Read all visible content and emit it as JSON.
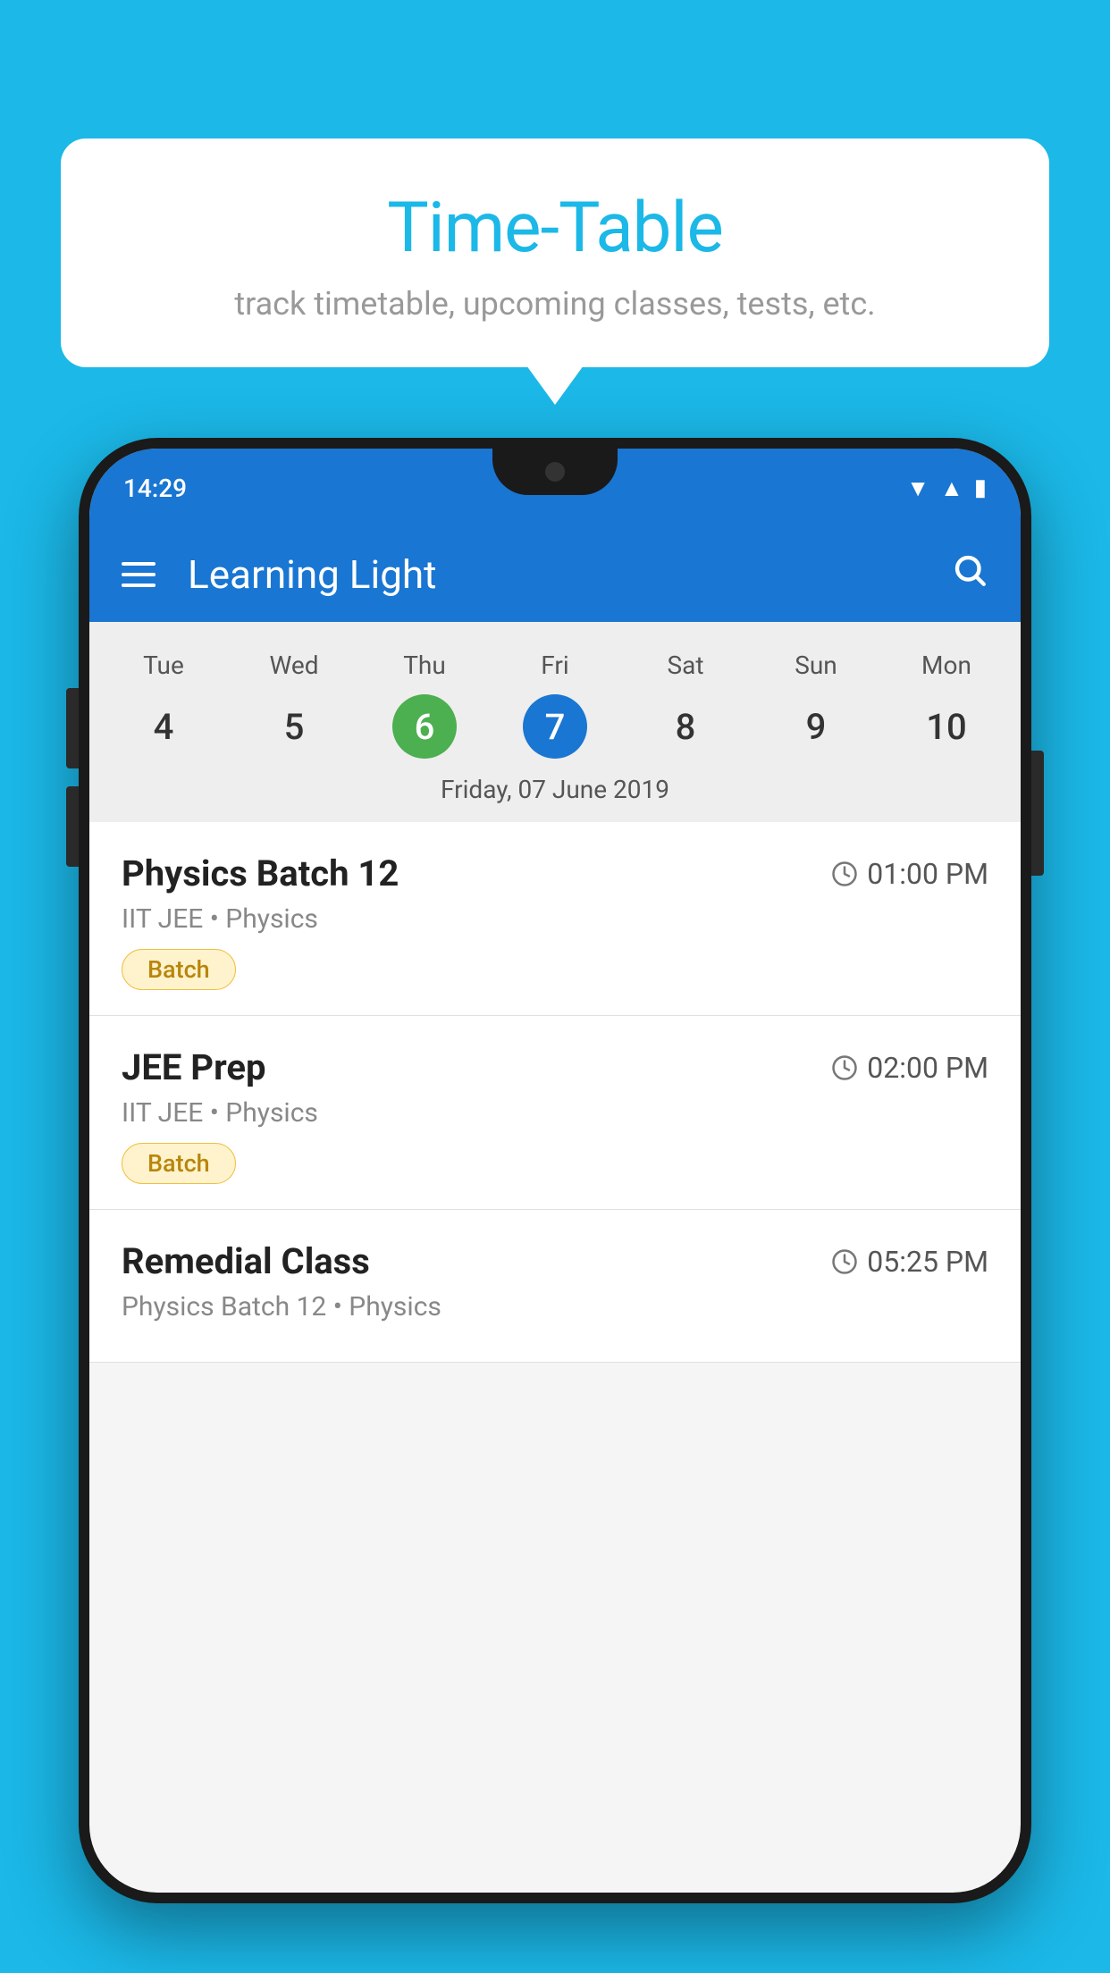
{
  "background_color": "#1BB8E8",
  "bubble": {
    "title": "Time-Table",
    "subtitle": "track timetable, upcoming classes, tests, etc."
  },
  "phone": {
    "status_time": "14:29",
    "app_bar": {
      "title": "Learning Light"
    },
    "calendar": {
      "days": [
        {
          "label": "Tue",
          "num": "4",
          "state": "normal"
        },
        {
          "label": "Wed",
          "num": "5",
          "state": "normal"
        },
        {
          "label": "Thu",
          "num": "6",
          "state": "today"
        },
        {
          "label": "Fri",
          "num": "7",
          "state": "selected"
        },
        {
          "label": "Sat",
          "num": "8",
          "state": "normal"
        },
        {
          "label": "Sun",
          "num": "9",
          "state": "normal"
        },
        {
          "label": "Mon",
          "num": "10",
          "state": "normal"
        }
      ],
      "selected_date_label": "Friday, 07 June 2019"
    },
    "schedule": [
      {
        "title": "Physics Batch 12",
        "time": "01:00 PM",
        "sub": "IIT JEE • Physics",
        "badge": "Batch"
      },
      {
        "title": "JEE Prep",
        "time": "02:00 PM",
        "sub": "IIT JEE • Physics",
        "badge": "Batch"
      },
      {
        "title": "Remedial Class",
        "time": "05:25 PM",
        "sub": "Physics Batch 12 • Physics",
        "badge": null
      }
    ]
  }
}
